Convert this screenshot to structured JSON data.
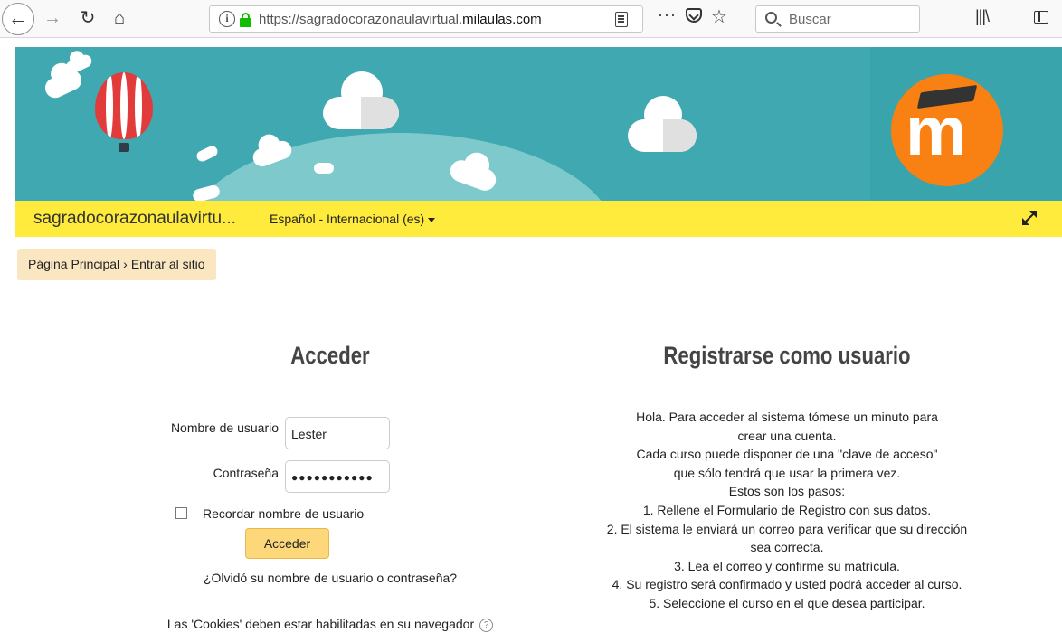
{
  "browser": {
    "url_prefix": "https://sagradocorazonaulavirtual.",
    "url_domain": "milaulas.com",
    "search_placeholder": "Buscar",
    "icons": [
      "back-icon",
      "forward-icon",
      "reload-icon",
      "home-icon",
      "info-icon",
      "lock-icon",
      "reader-view-icon",
      "page-actions-icon",
      "pocket-icon",
      "bookmark-star-icon",
      "search-icon",
      "library-icon",
      "sidebar-icon"
    ]
  },
  "navbar": {
    "site_name": "sagradocorazonaulavirtu...",
    "language": "Español - Internacional (es)"
  },
  "breadcrumb": {
    "home": "Página Principal",
    "separator": "›",
    "current": "Entrar al sitio"
  },
  "login": {
    "heading": "Acceder",
    "username_label": "Nombre de usuario",
    "username_value": "Lester",
    "password_label": "Contraseña",
    "password_value": "●●●●●●●●●●●",
    "remember_label": "Recordar nombre de usuario",
    "submit_label": "Acceder",
    "forgot_link": "¿Olvidó su nombre de usuario o contraseña?",
    "cookies_notice": "Las 'Cookies' deben estar habilitadas en su navegador"
  },
  "register": {
    "heading": "Registrarse como usuario",
    "lines": [
      "Hola. Para acceder al sistema tómese un minuto para",
      "crear una cuenta.",
      "Cada curso puede disponer de una \"clave de acceso\"",
      "que sólo tendrá que usar la primera vez.",
      "Estos son los pasos:",
      "1. Rellene el Formulario de Registro con sus datos.",
      "2. El sistema le enviará un correo para verificar que su dirección",
      "sea correcta.",
      "3. Lea el correo y confirme su matrícula.",
      "4. Su registro será confirmado y usted podrá acceder al curso.",
      "5. Seleccione el curso en el que desea participar."
    ]
  },
  "colors": {
    "banner": "#3fa8b0",
    "navbar": "#ffeb3b",
    "breadcrumb": "#fbe6c2",
    "button": "#fcd87a",
    "moodle_orange": "#f98012"
  }
}
